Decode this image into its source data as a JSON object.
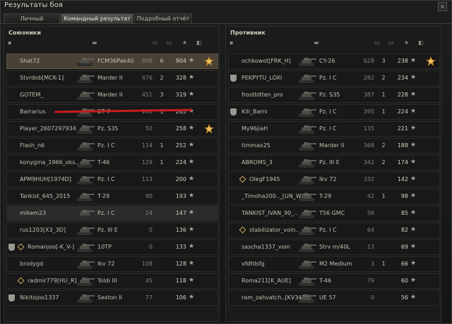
{
  "window": {
    "title": "Результаты боя",
    "close_label": "×"
  },
  "tabs": [
    {
      "label": "Личный результат",
      "active": false
    },
    {
      "label": "Командный результат",
      "active": true
    },
    {
      "label": "Подробный отчёт",
      "active": false
    }
  ],
  "allies": {
    "title": "Союзники",
    "rows": [
      {
        "player": "Shat72",
        "vehicle": "FCM36Pak40",
        "damage": "898",
        "kills": "6",
        "xp": "904",
        "medal": true,
        "highlight": true
      },
      {
        "player": "Stvrdob[MCK-1]",
        "vehicle": "Marder II",
        "damage": "476",
        "kills": "2",
        "xp": "328"
      },
      {
        "player": "GOTEM_",
        "vehicle": "Marder II",
        "damage": "451",
        "kills": "3",
        "xp": "319"
      },
      {
        "player": "Barrarius",
        "vehicle": "БТ-7",
        "damage": "141",
        "kills": "1",
        "xp": "265"
      },
      {
        "player": "Player_2607297934",
        "vehicle": "Pz. S35",
        "damage": "50",
        "kills": "",
        "xp": "258",
        "medal": true
      },
      {
        "player": "Flash_n6",
        "vehicle": "Pz. I C",
        "damage": "114",
        "kills": "1",
        "xp": "252"
      },
      {
        "player": "konygina_1966_oks..",
        "vehicle": "T-46",
        "damage": "129",
        "kills": "1",
        "xp": "224"
      },
      {
        "player": "APM9HUH[1974D]",
        "vehicle": "Pz. I C",
        "damage": "113",
        "kills": "",
        "xp": "200"
      },
      {
        "player": "Tankist_645_2015",
        "vehicle": "T-29",
        "damage": "90",
        "kills": "",
        "xp": "193"
      },
      {
        "player": "mikem23",
        "vehicle": "Pz. I C",
        "damage": "24",
        "kills": "",
        "xp": "147",
        "alt": true
      },
      {
        "player": "rus1203[X3_3D]",
        "vehicle": "Pz. III E",
        "damage": "0",
        "kills": "",
        "xp": "136"
      },
      {
        "player": "Romanjoo[-K_V-]",
        "vehicle": "10TP",
        "damage": "0",
        "kills": "",
        "xp": "133",
        "badge": true,
        "diamond": true
      },
      {
        "player": "brodygd",
        "vehicle": "Ikv 72",
        "damage": "108",
        "kills": "",
        "xp": "128"
      },
      {
        "player": "radmir779[HU_R]",
        "vehicle": "Toldi III",
        "damage": "45",
        "kills": "",
        "xp": "118",
        "diamond": true
      },
      {
        "player": "Nikitojoo1337",
        "vehicle": "Sexton II",
        "damage": "77",
        "kills": "",
        "xp": "106",
        "badge": true
      }
    ]
  },
  "enemies": {
    "title": "Противник",
    "rows": [
      {
        "player": "ochkowot[FRK_H]",
        "vehicle": "CY-26",
        "damage": "628",
        "kills": "3",
        "xp": "238",
        "medal": true
      },
      {
        "player": "PEKPYTU_LOXI",
        "vehicle": "Pz. I C",
        "damage": "282",
        "kills": "2",
        "xp": "234",
        "badge": true
      },
      {
        "player": "frostbitten_pro",
        "vehicle": "Pz. S35",
        "damage": "387",
        "kills": "1",
        "xp": "228"
      },
      {
        "player": "Kill_Barni",
        "vehicle": "Pz. I C",
        "damage": "395",
        "kills": "1",
        "xp": "224",
        "badge": true
      },
      {
        "player": "My96jiaH",
        "vehicle": "Pz. I C",
        "damage": "135",
        "kills": "",
        "xp": "221"
      },
      {
        "player": "timmax25",
        "vehicle": "Marder II",
        "damage": "368",
        "kills": "2",
        "xp": "188"
      },
      {
        "player": "ABROMS_3",
        "vehicle": "Pz. III E",
        "damage": "342",
        "kills": "2",
        "xp": "174"
      },
      {
        "player": "OlegF1945",
        "vehicle": "Ikv 72",
        "damage": "332",
        "kills": "",
        "xp": "142",
        "diamond": true
      },
      {
        "player": "_Timoha200.._[UN_W]",
        "vehicle": "T-29",
        "damage": "42",
        "kills": "1",
        "xp": "98"
      },
      {
        "player": "TANKIST_IVAN_90_..",
        "vehicle": "T56 GMC",
        "damage": "58",
        "kills": "",
        "xp": "85"
      },
      {
        "player": "stabilizator_voin..",
        "vehicle": "Pz. I C",
        "damage": "64",
        "kills": "",
        "xp": "82",
        "diamond": true
      },
      {
        "player": "sascha1337_voin",
        "vehicle": "Strv m/40L",
        "damage": "13",
        "kills": "",
        "xp": "69"
      },
      {
        "player": "vfdfdsfg",
        "vehicle": "M2 Medium",
        "damage": "3",
        "kills": "1",
        "xp": "66"
      },
      {
        "player": "Roma211[K_AUE]",
        "vehicle": "T-46",
        "damage": "79",
        "kills": "",
        "xp": "60"
      },
      {
        "player": "ram_zahvatch..[KV34]",
        "vehicle": "UE 57",
        "damage": "0",
        "kills": "",
        "xp": "56"
      }
    ]
  },
  "icons": {
    "star": "★",
    "medal": "medal-icon",
    "tank": "tank-icon",
    "badge": "rank-badge-icon"
  }
}
